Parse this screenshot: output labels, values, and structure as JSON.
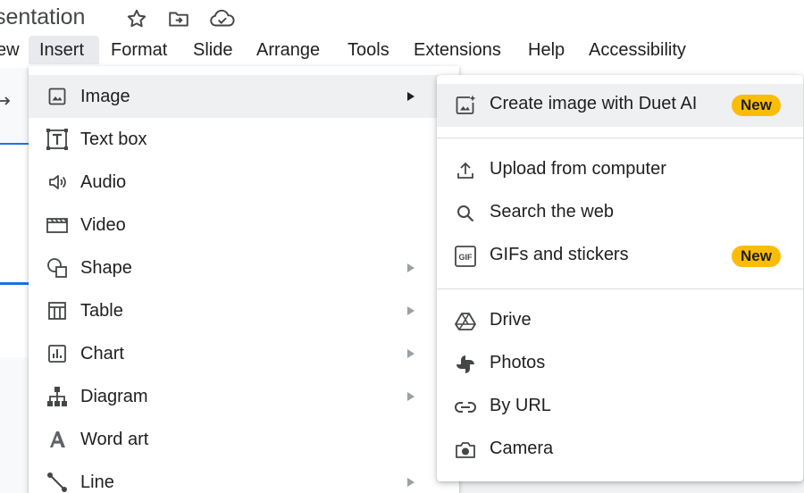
{
  "header": {
    "doc_title": "sentation",
    "icons": [
      "star-icon",
      "move-to-folder-icon",
      "cloud-saved-icon"
    ]
  },
  "menubar": {
    "items": [
      {
        "label": "ew"
      },
      {
        "label": "Insert"
      },
      {
        "label": "Format"
      },
      {
        "label": "Slide"
      },
      {
        "label": "Arrange"
      },
      {
        "label": "Tools"
      },
      {
        "label": "Extensions"
      },
      {
        "label": "Help"
      },
      {
        "label": "Accessibility"
      }
    ],
    "active": "Insert"
  },
  "insert_menu": {
    "items": [
      {
        "label": "Image",
        "icon": "image-icon",
        "has_submenu": true
      },
      {
        "label": "Text box",
        "icon": "text-box-icon",
        "has_submenu": false
      },
      {
        "label": "Audio",
        "icon": "audio-icon",
        "has_submenu": false
      },
      {
        "label": "Video",
        "icon": "video-icon",
        "has_submenu": false
      },
      {
        "label": "Shape",
        "icon": "shape-icon",
        "has_submenu": true
      },
      {
        "label": "Table",
        "icon": "table-icon",
        "has_submenu": true
      },
      {
        "label": "Chart",
        "icon": "chart-icon",
        "has_submenu": true
      },
      {
        "label": "Diagram",
        "icon": "diagram-icon",
        "has_submenu": true
      },
      {
        "label": "Word art",
        "icon": "word-art-icon",
        "has_submenu": false
      },
      {
        "label": "Line",
        "icon": "line-icon",
        "has_submenu": true
      }
    ]
  },
  "image_submenu": {
    "items": [
      {
        "label": "Create image with Duet AI",
        "icon": "ai-image-icon",
        "badge": "New"
      },
      {
        "label": "Upload from computer",
        "icon": "upload-icon"
      },
      {
        "label": "Search the web",
        "icon": "search-icon"
      },
      {
        "label": "GIFs and stickers",
        "icon": "gif-icon",
        "badge": "New"
      },
      {
        "label": "Drive",
        "icon": "drive-icon"
      },
      {
        "label": "Photos",
        "icon": "photos-icon"
      },
      {
        "label": "By URL",
        "icon": "link-icon"
      },
      {
        "label": "Camera",
        "icon": "camera-icon"
      }
    ]
  },
  "colors": {
    "badge": "#fbbc04",
    "highlight": "#eef0f2",
    "accent": "#1a73e8"
  }
}
